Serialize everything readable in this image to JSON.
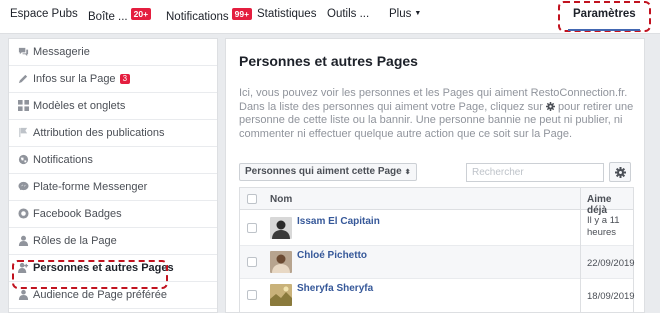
{
  "topnav": {
    "items": [
      {
        "label": "Espace Pubs"
      },
      {
        "label": "Boîte ...",
        "badge": "20+"
      },
      {
        "label": "Notifications",
        "badge": "99+"
      },
      {
        "label": "Statistiques"
      },
      {
        "label": "Outils ..."
      },
      {
        "label": "Plus"
      }
    ],
    "active": "Paramètres"
  },
  "sidebar": {
    "items": [
      {
        "label": "Messagerie",
        "icon": "messages-icon"
      },
      {
        "label": "Infos sur la Page",
        "icon": "pencil-icon",
        "badge": "3"
      },
      {
        "label": "Modèles et onglets",
        "icon": "grid-icon"
      },
      {
        "label": "Attribution des publications",
        "icon": "flag-icon"
      },
      {
        "label": "Notifications",
        "icon": "globe-icon"
      },
      {
        "label": "Plate-forme Messenger",
        "icon": "messenger-icon"
      },
      {
        "label": "Facebook Badges",
        "icon": "badge-icon"
      },
      {
        "label": "Rôles de la Page",
        "icon": "person-icon"
      },
      {
        "label": "Personnes et autres Pages",
        "icon": "people-icon",
        "active": true
      },
      {
        "label": "Audience de Page préférée",
        "icon": "audience-icon"
      }
    ]
  },
  "main": {
    "title": "Personnes et autres Pages",
    "desc_1": "Ici, vous pouvez voir les personnes et les Pages qui aiment RestoConnection.fr. Dans la liste des personnes qui aiment votre Page, cliquez sur",
    "desc_2": "pour retirer une personne de cette liste ou la bannir. Une personne bannie ne peut ni publier, ni commenter ni effectuer quelque autre action que ce soit sur la Page.",
    "filter_label": "Personnes qui aiment cette Page",
    "search_placeholder": "Rechercher",
    "table": {
      "col_name": "Nom",
      "col_date": "Aime déjà",
      "rows": [
        {
          "name": "Issam El Capitain",
          "date": "Il y a 11 heures"
        },
        {
          "name": "Chloé Pichetto",
          "date": "22/09/2019"
        },
        {
          "name": "Sheryfa Sheryfa",
          "date": "18/09/2019"
        }
      ]
    }
  },
  "colors": {
    "accent": "#4267b2",
    "link": "#365899",
    "badge": "#e41e3f",
    "highlight": "#c1121f"
  }
}
